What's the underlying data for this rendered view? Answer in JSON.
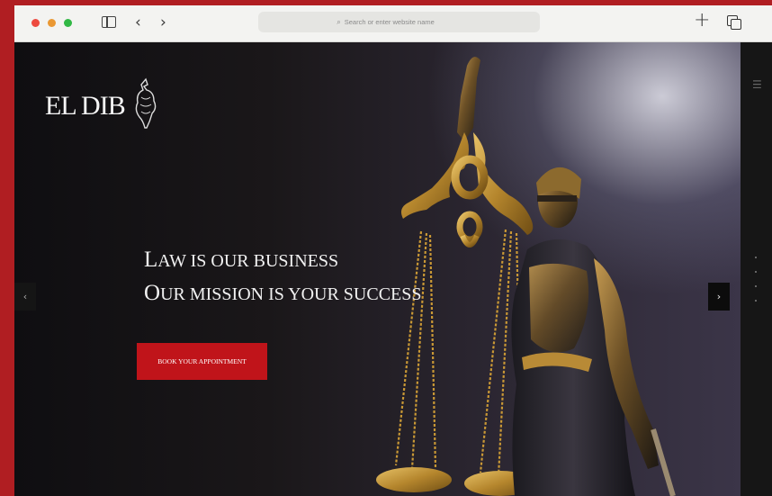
{
  "browser": {
    "address_placeholder": "Search or enter website name"
  },
  "site": {
    "logo_text": "EL DIB",
    "headline": [
      {
        "cap": "L",
        "rest": "AW IS OUR BUSINESS"
      },
      {
        "cap": "O",
        "rest": "UR MISSION IS YOUR SUCCESS"
      }
    ],
    "cta_label": "BOOK YOUR APPOINTMENT",
    "prev_arrow": "‹",
    "next_arrow": "›"
  },
  "icons": {
    "back": "chevron-left-icon",
    "forward": "chevron-right-icon",
    "new_tab": "plus-icon",
    "tabs": "tabs-overview-icon",
    "menu": "hamburger-menu-icon"
  },
  "colors": {
    "frame_red": "#b01e22",
    "cta_red": "#c0141a",
    "hero_dark": "#111111"
  }
}
